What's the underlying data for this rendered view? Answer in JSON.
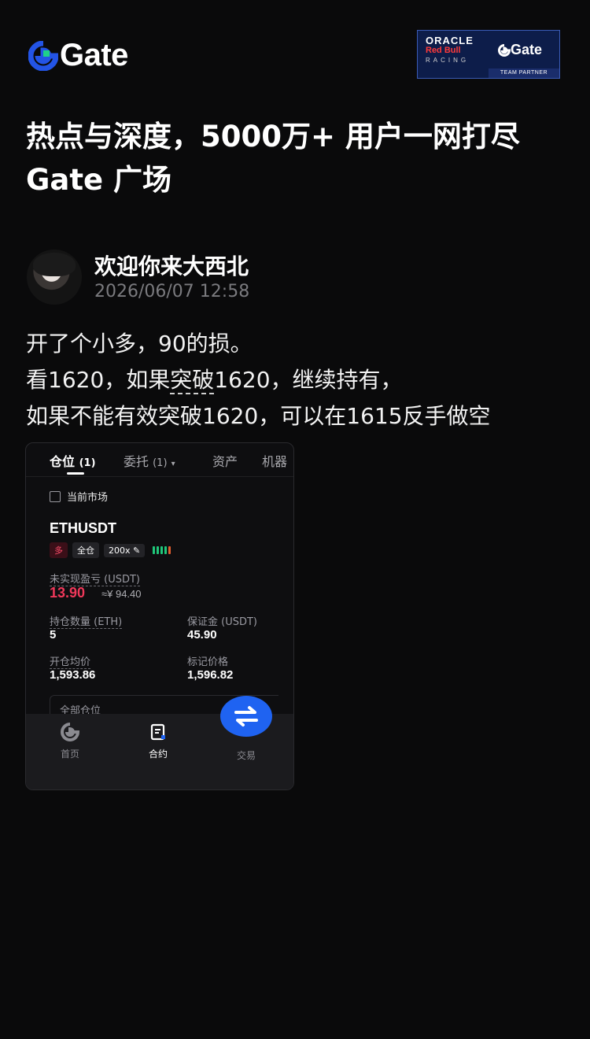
{
  "header": {
    "logo_text": "Gate",
    "partner": {
      "oracle": "ORACLE",
      "redbull": "Red Bull",
      "racing": "RACING",
      "gate": "Gate",
      "badge": "TEAM PARTNER"
    },
    "headline_line1": "热点与深度，5000万+ 用户一网打尽",
    "headline_line2": "Gate 广场"
  },
  "post": {
    "author": "欢迎你来大西北",
    "timestamp": "2026/06/07 12:58",
    "line1": "开了个小多，90的损。",
    "line2_a": "看1620，如果",
    "line2_u": "突破",
    "line2_b": "1620，继续持有，",
    "line3": "如果不能有效突破1620，可以在1615反手做空"
  },
  "screenshot": {
    "tabs": [
      {
        "label": "仓位",
        "count": "(1)"
      },
      {
        "label": "委托",
        "count": "(1)"
      },
      {
        "label": "资产",
        "count": ""
      },
      {
        "label": "机器",
        "count": ""
      }
    ],
    "checkbox_label": "当前市场",
    "symbol": "ETHUSDT",
    "tags": {
      "side": "多",
      "mode": "全仓",
      "leverage": "200x"
    },
    "unrealized_label": "未实现盈亏 (USDT)",
    "unrealized_value": "13.90",
    "unrealized_cny": "≈¥ 94.40",
    "size_label": "持仓数量 (ETH)",
    "size_value": "5",
    "margin_label": "保证金 (USDT)",
    "margin_value": "45.90",
    "entry_label": "开仓均价",
    "entry_value": "1,593.86",
    "mark_label": "标记价格",
    "mark_value": "1,596.82",
    "all_positions": "全部仓位",
    "nav": [
      {
        "label": "首页",
        "icon": "gate-home-icon"
      },
      {
        "label": "合约",
        "icon": "futures-icon"
      },
      {
        "label": "交易",
        "icon": "swap-arrows-icon"
      }
    ],
    "colors": {
      "accent": "#1f63f1",
      "profit": "#f0385a",
      "long_tag": "#ff4d6a"
    }
  }
}
